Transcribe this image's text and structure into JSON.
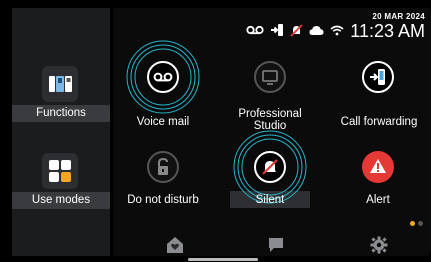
{
  "status": {
    "date": "20 MAR 2024",
    "time": "11:23 AM",
    "icons": [
      "voicemail-icon",
      "call-forwarding-icon",
      "silent-icon",
      "cloud-icon",
      "wifi-icon"
    ]
  },
  "sidebar": {
    "items": [
      {
        "label": "Functions",
        "icon": "functions-icon"
      },
      {
        "label": "Use modes",
        "icon": "use-modes-icon"
      }
    ]
  },
  "tiles": [
    {
      "label": "Voice mail",
      "icon": "voicemail-icon",
      "active": true
    },
    {
      "label": "Professional",
      "label2": "Studio",
      "icon": "monitor-icon",
      "active": false
    },
    {
      "label": "Call forwarding",
      "icon": "call-forwarding-icon",
      "active": true
    },
    {
      "label": "Do not disturb",
      "icon": "lock-icon",
      "active": false
    },
    {
      "label": "Silent",
      "icon": "silent-icon",
      "active": true
    },
    {
      "label": "Alert",
      "icon": "alert-icon",
      "active": true
    }
  ],
  "bottom_nav": [
    {
      "icon": "home-icon"
    },
    {
      "icon": "chat-icon"
    },
    {
      "icon": "settings-icon"
    }
  ],
  "colors": {
    "accent": "#f5a623",
    "alert": "#e53935",
    "highlight": "#27b6c9"
  }
}
